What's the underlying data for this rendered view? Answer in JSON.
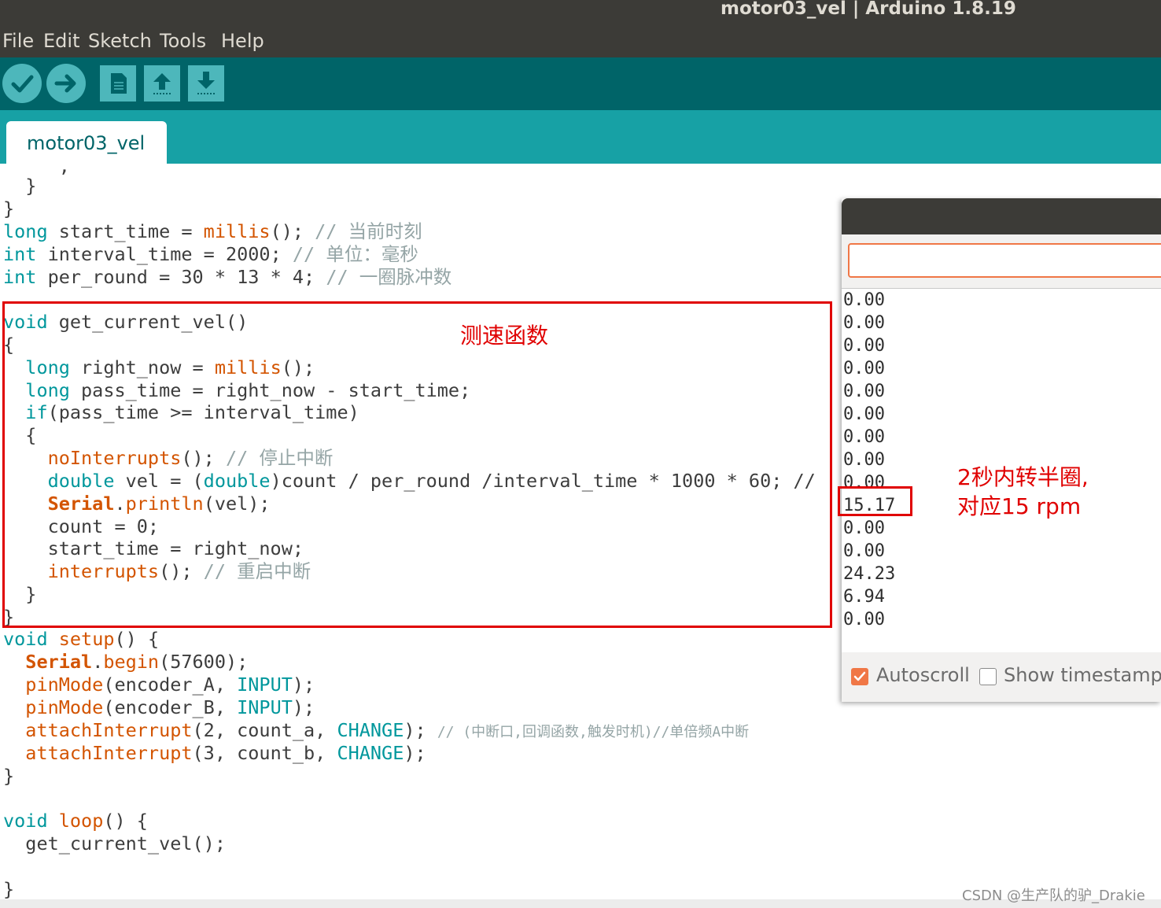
{
  "window": {
    "title": "motor03_vel | Arduino 1.8.19"
  },
  "menu": [
    "File",
    "Edit",
    "Sketch",
    "Tools",
    "Help"
  ],
  "toolbar": {
    "buttons": [
      "verify-button",
      "upload-button",
      "new-button",
      "open-button",
      "save-button"
    ]
  },
  "tab": {
    "label": "motor03_vel"
  },
  "code": {
    "line01": "  }",
    "line02": "}",
    "line03": {
      "kw": "long",
      "a": " start_time = ",
      "fn": "millis",
      "b": "(); ",
      "cm": "// 当前时刻"
    },
    "line04": {
      "kw": "int",
      "a": " interval_time = 2000; ",
      "cm": "// 单位：毫秒"
    },
    "line05": {
      "kw": "int",
      "a": " per_round = 30 * 13 * 4; ",
      "cm": "// 一圈脉冲数"
    },
    "line06": {
      "kw": "void",
      "a": " get_current_vel()"
    },
    "line07": "{",
    "line08": {
      "pre": "  ",
      "kw": "long",
      "a": " right_now = ",
      "fn": "millis",
      "b": "();"
    },
    "line09": {
      "pre": "  ",
      "kw": "long",
      "a": " pass_time = right_now - start_time;"
    },
    "line10": {
      "pre": "  ",
      "kw": "if",
      "a": "(pass_time >= interval_time)"
    },
    "line11": "  {",
    "line12": {
      "pre": "    ",
      "fn": "noInterrupts",
      "a": "(); ",
      "cm": "// 停止中断"
    },
    "line13": {
      "pre": "    ",
      "kw": "double",
      "a": " vel = (",
      "kw2": "double",
      "b": ")count / per_round /interval_time * 1000 * 60; //"
    },
    "line14": {
      "pre": "    ",
      "ob": "Serial",
      "a": ".",
      "fn": "println",
      "b": "(vel);"
    },
    "line15": "    count = 0;",
    "line16": "    start_time = right_now;",
    "line17": {
      "pre": "    ",
      "fn": "interrupts",
      "a": "(); ",
      "cm": "// 重启中断"
    },
    "line18": "  }",
    "line19": "}",
    "line20": {
      "kw": "void",
      "a": " ",
      "fn": "setup",
      "b": "() {"
    },
    "line21": {
      "pre": "  ",
      "ob": "Serial",
      "a": ".",
      "fn": "begin",
      "b": "(57600);"
    },
    "line22": {
      "pre": "  ",
      "fn": "pinMode",
      "a": "(encoder_A, ",
      "kw": "INPUT",
      "b": ");"
    },
    "line23": {
      "pre": "  ",
      "fn": "pinMode",
      "a": "(encoder_B, ",
      "kw": "INPUT",
      "b": ");"
    },
    "line24": {
      "pre": "  ",
      "fn": "attachInterrupt",
      "a": "(2, count_a, ",
      "kw": "CHANGE",
      "b": "); ",
      "cm": "// (中断口,回调函数,触发时机)//单倍频A中断"
    },
    "line25": {
      "pre": "  ",
      "fn": "attachInterrupt",
      "a": "(3, count_b, ",
      "kw": "CHANGE",
      "b": ");"
    },
    "line26": "}",
    "line27": {
      "kw": "void",
      "a": " ",
      "fn": "loop",
      "b": "() {"
    },
    "line28": "  get_current_vel();",
    "line29": "}"
  },
  "annotations": {
    "function_label": "测速函数",
    "speed_note_line1": "2秒内转半圈,",
    "speed_note_line2": "对应15 rpm"
  },
  "serial_monitor": {
    "input_value": "",
    "output": [
      "0.00",
      "0.00",
      "0.00",
      "0.00",
      "0.00",
      "0.00",
      "0.00",
      "0.00",
      "0.00",
      "15.17",
      "0.00",
      "0.00",
      "24.23",
      "6.94",
      "0.00"
    ],
    "autoscroll_label": "Autoscroll",
    "autoscroll_checked": true,
    "timestamp_label": "Show timestamp",
    "timestamp_checked": false
  },
  "watermark": "CSDN @生产队的驴_Drakie",
  "colors": {
    "toolbar": "#006468",
    "tabstrip": "#17a1a5",
    "keyword": "#00979c",
    "function": "#d35400",
    "comment": "#95a5a6",
    "annotation_red": "#e00000",
    "accent_orange": "#f07746"
  }
}
